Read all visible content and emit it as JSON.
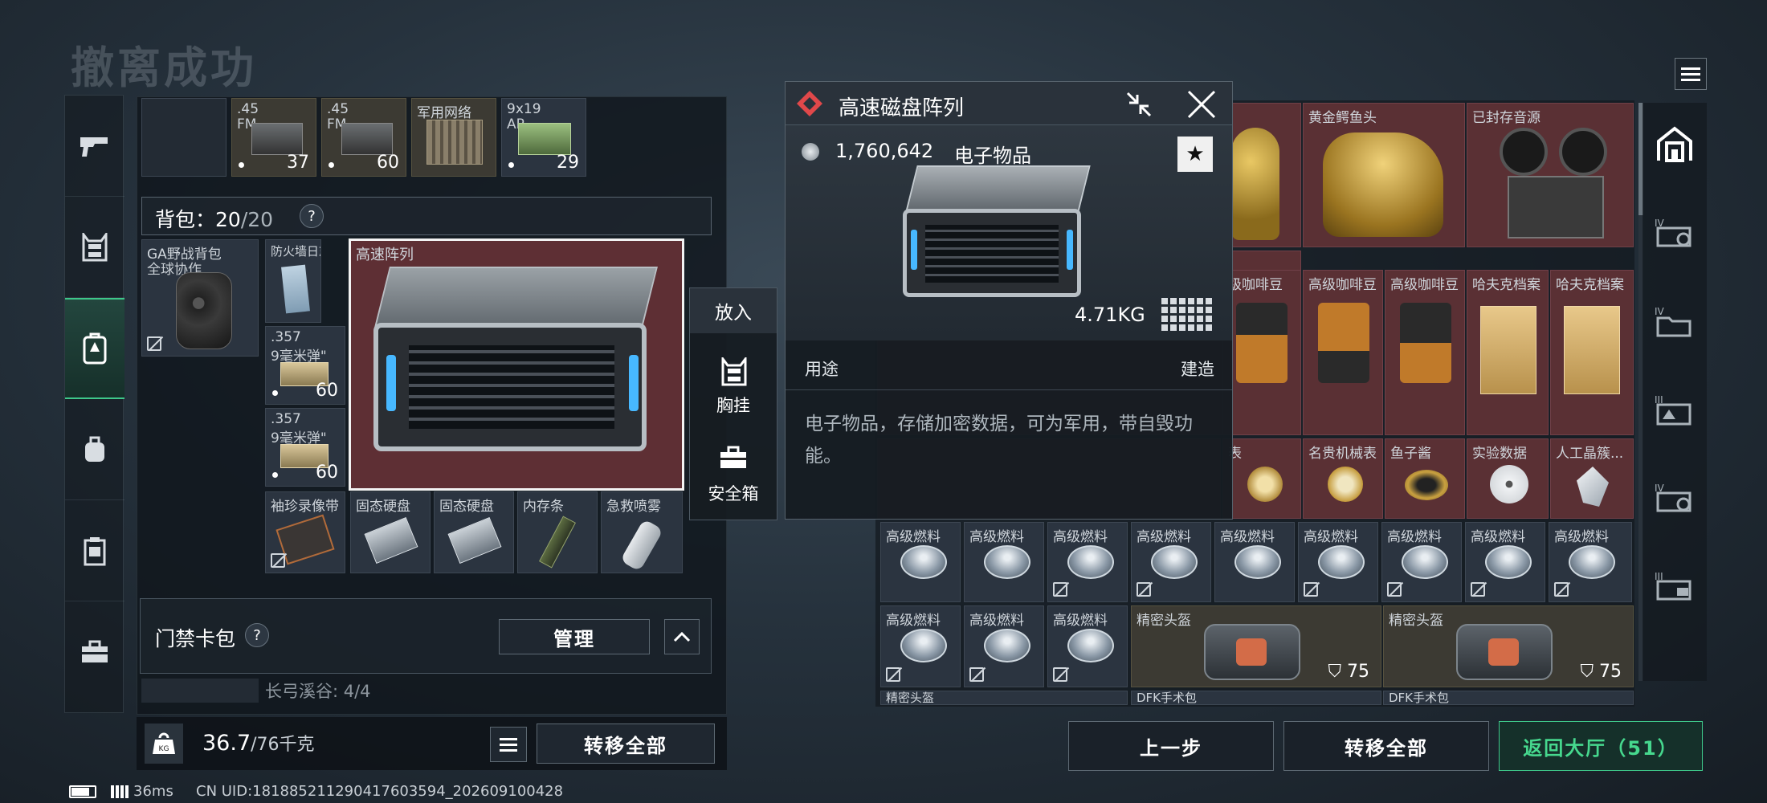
{
  "title": "撤离成功",
  "status_bar": {
    "ping": "36ms",
    "uid": "CN UID:18188521129041760359​4_202609100428"
  },
  "left_tabs": [
    {
      "icon": "pistol-icon"
    },
    {
      "icon": "chest-rig-icon"
    },
    {
      "icon": "backpack-icon",
      "active": true
    },
    {
      "icon": "rucksack-icon"
    },
    {
      "icon": "armor-icon"
    },
    {
      "icon": "toolbox-icon"
    }
  ],
  "ammo_row": [
    {
      "label": ".45",
      "label2": "FM",
      "count": "37"
    },
    {
      "label": ".45",
      "label2": "FM",
      "count": "60"
    },
    {
      "label": "军用网络",
      "label2": "",
      "count": ""
    },
    {
      "label": "9x19",
      "label2": "AP",
      "count": "29"
    }
  ],
  "backpack": {
    "label": "背包：",
    "used": "20",
    "sep": "/",
    "total": "20",
    "help": "?"
  },
  "backpack_item": {
    "name": "GA野战背包",
    "name2": "全球协作"
  },
  "grid_items": {
    "firewall_log": "防火墙日志",
    "disk_array": "高速阵列",
    "ammo1_name": ".357",
    "ammo1_name2": "9毫米弹\"",
    "ammo1_count": "60",
    "ammo2_name": ".357",
    "ammo2_name2": "9毫米弹\"",
    "ammo2_count": "60",
    "tape": "袖珍录像带",
    "ssd1": "固态硬盘",
    "ssd2": "固态硬盘",
    "ram": "内存条",
    "spray": "急救喷雾"
  },
  "keycard": {
    "label": "门禁卡包",
    "help": "?",
    "manage": "管理",
    "sub": "长弓溪谷: 4/4"
  },
  "weight": {
    "current": "36.7",
    "sep": "/",
    "max": "76千克",
    "transfer_all": "转移全部"
  },
  "context_menu": {
    "put_in": "放入",
    "chest_rig": "胸挂",
    "safebox": "安全箱"
  },
  "detail": {
    "title": "高速磁盘阵列",
    "price": "1,760,642",
    "category": "电子物品",
    "weight": "4.71KG",
    "tab_use": "用途",
    "tab_build": "建造",
    "description": "电子物品，存储加密数据，可为军用，带自毁功能。"
  },
  "stash": {
    "row1": [
      "黄金鳄鱼头",
      "已封存音源"
    ],
    "row2": [
      "级咖啡豆",
      "高级咖啡豆",
      "高级咖啡豆",
      "哈夫克档案",
      "哈夫克档案"
    ],
    "row3": [
      "表",
      "名贵机械表",
      "鱼子酱",
      "实验数据",
      "人工晶簇..."
    ],
    "fuel": "高级燃料",
    "helmet": "精密头盔",
    "helmet_value": "75",
    "partial": [
      "精密头盔",
      "DFK手术包",
      "DFK手术包"
    ]
  },
  "bottom_buttons": {
    "prev": "上一步",
    "transfer_all": "转移全部",
    "return": "返回大厅（51）"
  },
  "colors": {
    "accent_green": "#3ec78a",
    "selected_red": "#5e2f34",
    "gold_cell": "#3c3a33",
    "return_text": "#46d88e"
  }
}
